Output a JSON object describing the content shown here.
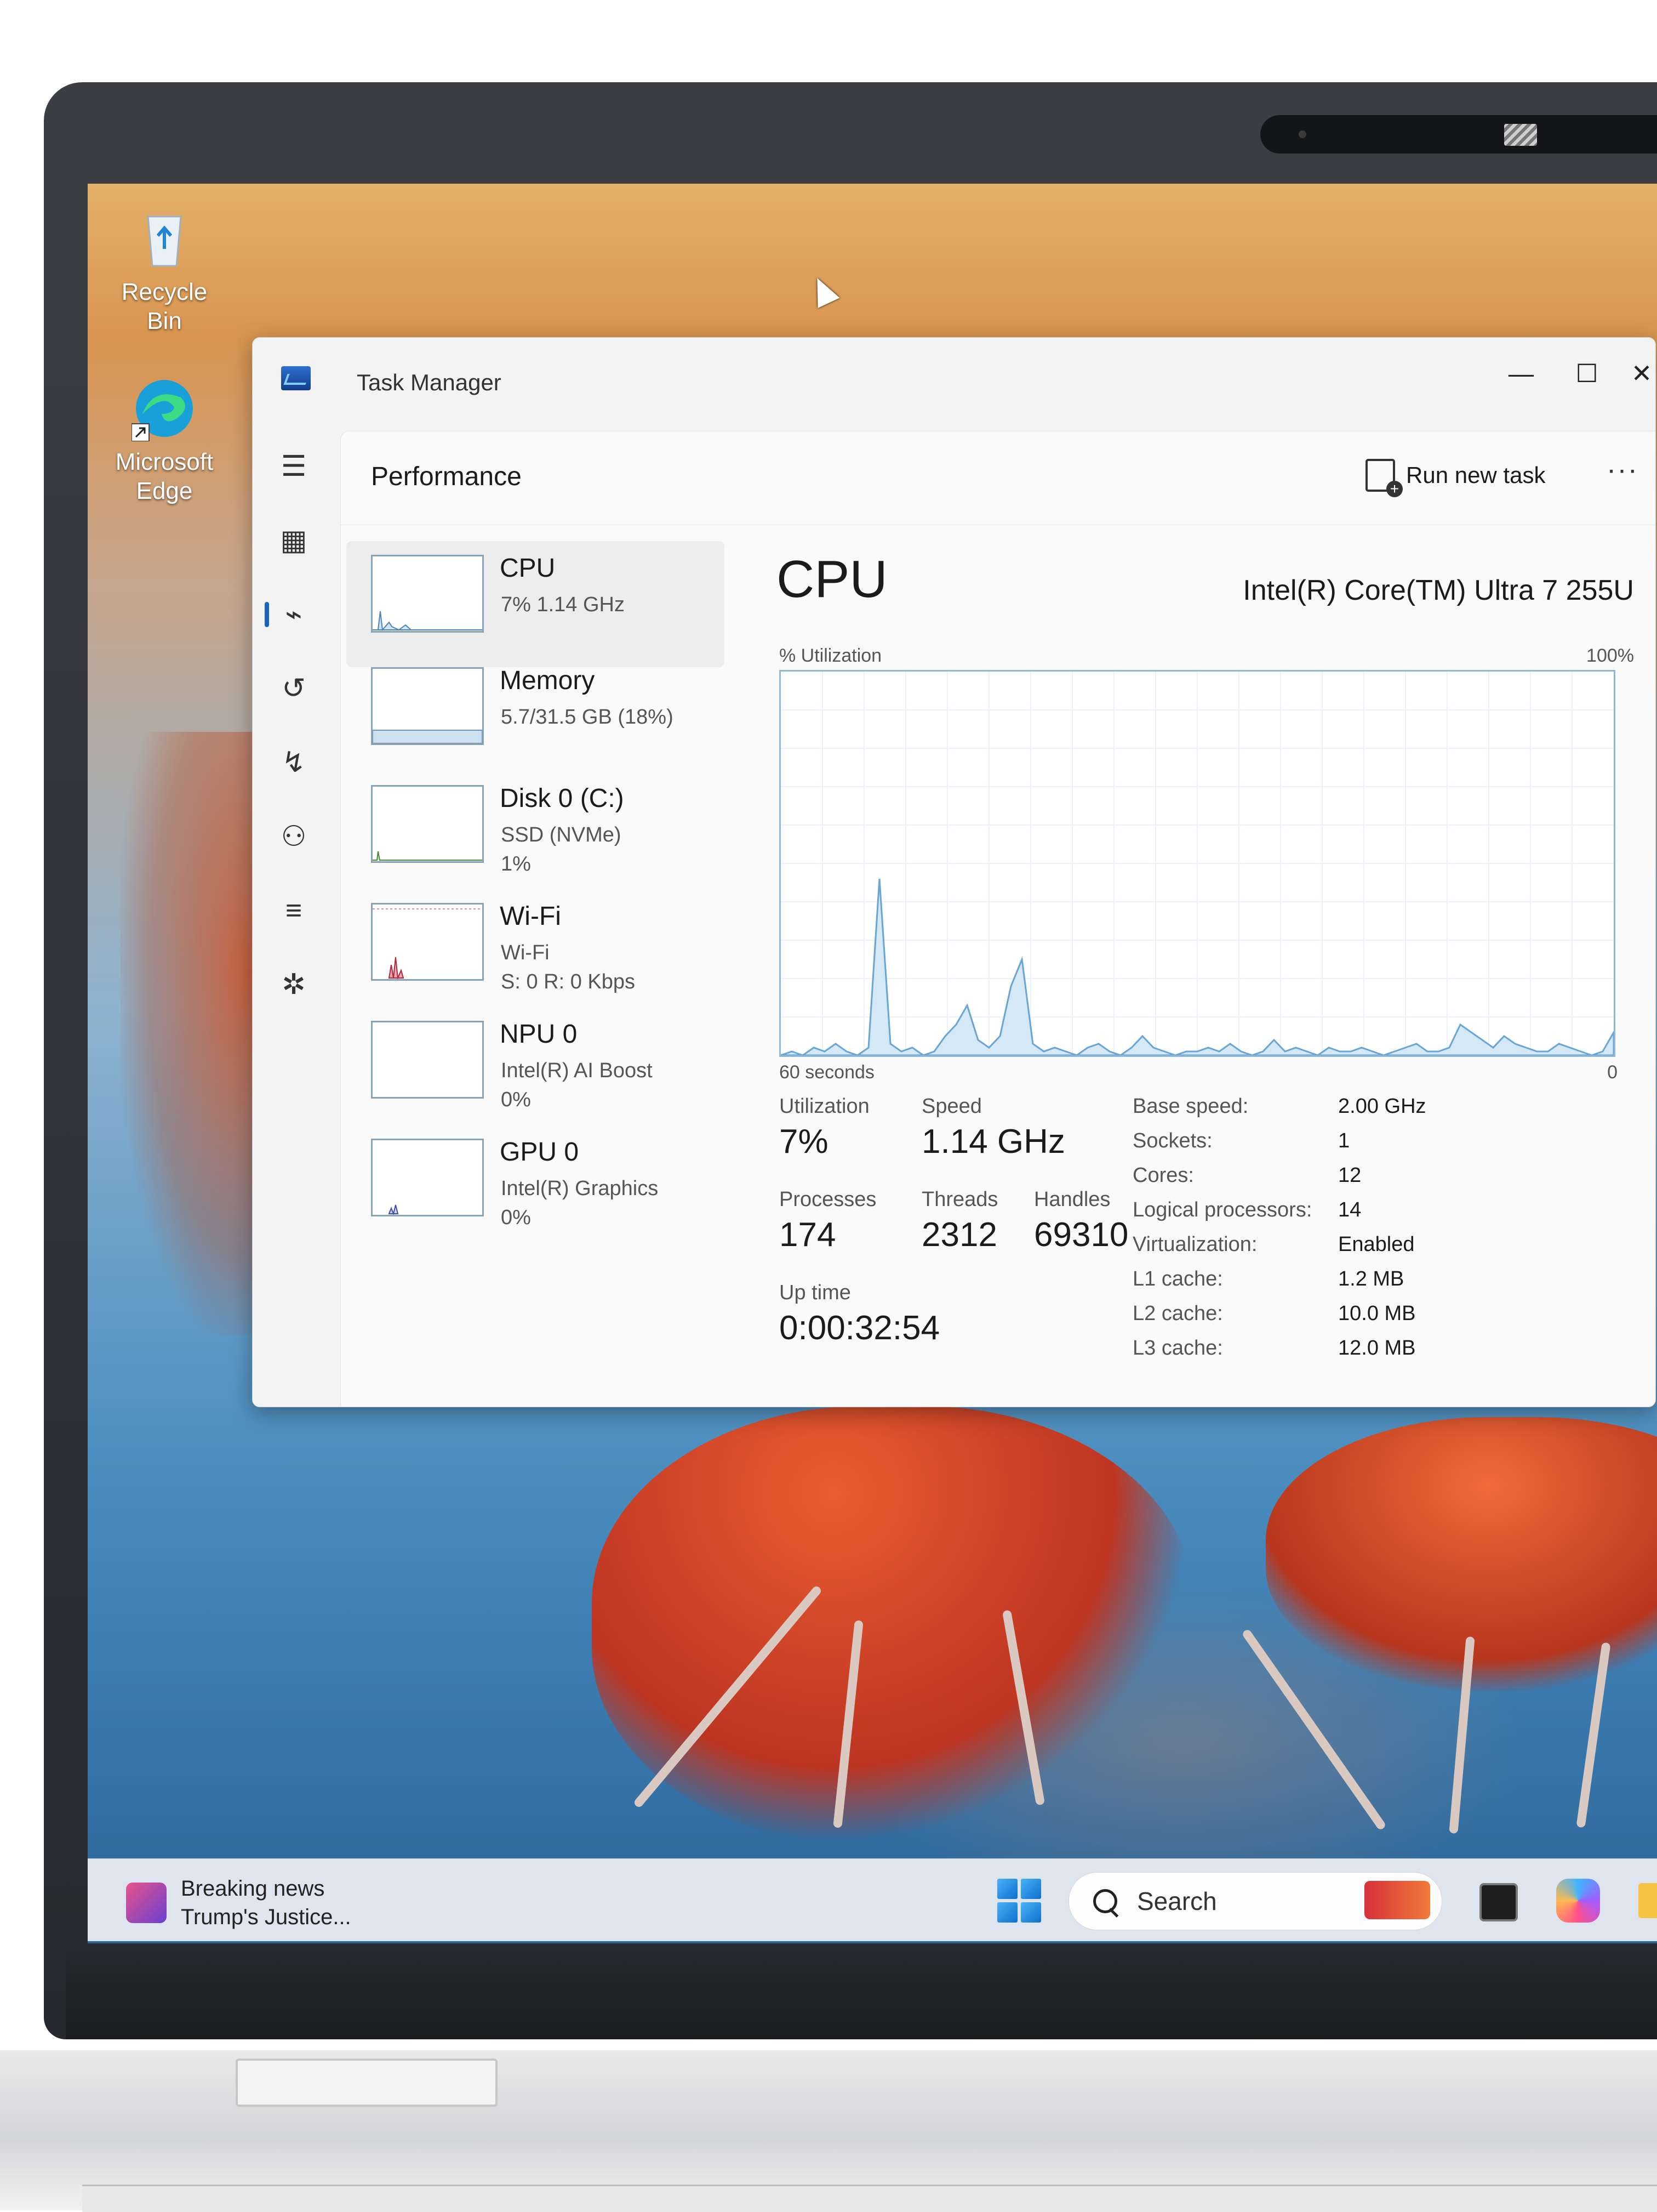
{
  "desktop": {
    "icons": [
      {
        "label": "Recycle Bin",
        "icon": "recycle-bin-icon"
      },
      {
        "label": "Microsoft Edge",
        "icon": "edge-icon"
      }
    ]
  },
  "window": {
    "title": "Task Manager",
    "controls": {
      "minimize": "—",
      "maximize": "☐",
      "close": "✕"
    }
  },
  "header": {
    "title": "Performance",
    "run_new_task": "Run new task",
    "more": "···"
  },
  "nav_icons": [
    "menu-icon",
    "processes-icon",
    "performance-icon",
    "app-history-icon",
    "startup-icon",
    "users-icon",
    "details-icon",
    "services-icon",
    "settings-icon"
  ],
  "resources": [
    {
      "name": "CPU",
      "sub1": "7% 1.14 GHz",
      "sub2": ""
    },
    {
      "name": "Memory",
      "sub1": "5.7/31.5 GB (18%)",
      "sub2": ""
    },
    {
      "name": "Disk 0 (C:)",
      "sub1": "SSD (NVMe)",
      "sub2": "1%"
    },
    {
      "name": "Wi-Fi",
      "sub1": "Wi-Fi",
      "sub2": "S: 0 R: 0 Kbps"
    },
    {
      "name": "NPU 0",
      "sub1": "Intel(R) AI Boost",
      "sub2": "0%"
    },
    {
      "name": "GPU 0",
      "sub1": "Intel(R) Graphics",
      "sub2": "0%"
    }
  ],
  "cpu": {
    "title": "CPU",
    "model": "Intel(R) Core(TM) Ultra 7 255U",
    "util_label": "% Utilization",
    "util_max": "100%",
    "graph_left": "60 seconds",
    "graph_right": "0",
    "stats": {
      "utilization_label": "Utilization",
      "utilization": "7%",
      "speed_label": "Speed",
      "speed": "1.14 GHz",
      "processes_label": "Processes",
      "processes": "174",
      "threads_label": "Threads",
      "threads": "2312",
      "handles_label": "Handles",
      "handles": "69310",
      "uptime_label": "Up time",
      "uptime": "0:00:32:54"
    },
    "details": [
      {
        "k": "Base speed:",
        "v": "2.00 GHz"
      },
      {
        "k": "Sockets:",
        "v": "1"
      },
      {
        "k": "Cores:",
        "v": "12"
      },
      {
        "k": "Logical processors:",
        "v": "14"
      },
      {
        "k": "Virtualization:",
        "v": "Enabled"
      },
      {
        "k": "L1 cache:",
        "v": "1.2 MB"
      },
      {
        "k": "L2 cache:",
        "v": "10.0 MB"
      },
      {
        "k": "L3 cache:",
        "v": "12.0 MB"
      }
    ],
    "history": [
      0,
      1,
      0,
      2,
      1,
      3,
      1,
      0,
      2,
      46,
      3,
      1,
      2,
      0,
      1,
      5,
      8,
      13,
      4,
      2,
      5,
      18,
      25,
      3,
      1,
      2,
      1,
      0,
      2,
      3,
      1,
      0,
      2,
      5,
      2,
      1,
      0,
      1,
      1,
      2,
      1,
      3,
      1,
      0,
      1,
      4,
      1,
      2,
      1,
      0,
      2,
      1,
      1,
      2,
      1,
      0,
      1,
      2,
      3,
      1,
      1,
      2,
      8,
      6,
      4,
      2,
      5,
      3,
      2,
      1,
      1,
      3,
      2,
      1,
      0,
      1,
      6
    ]
  },
  "taskbar": {
    "news_title": "Breaking news",
    "news_sub": "Trump's Justice...",
    "search": "Search"
  },
  "colors": {
    "graph_line": "#69a6d6",
    "graph_fill": "#d4e8f6",
    "accent": "#1565c0"
  }
}
